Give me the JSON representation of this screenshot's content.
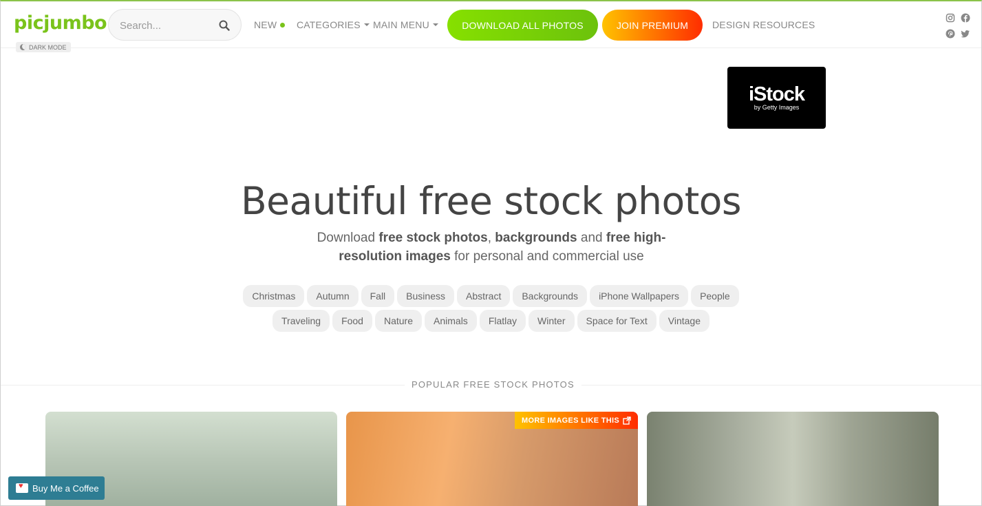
{
  "header": {
    "logo": "picjumbo",
    "dark_mode_label": "DARK MODE",
    "search_placeholder": "Search...",
    "nav": {
      "new": "NEW",
      "categories": "CATEGORIES",
      "main_menu": "MAIN MENU",
      "download_all": "DOWNLOAD ALL PHOTOS",
      "join_premium": "JOIN PREMIUM",
      "design_resources": "DESIGN RESOURCES"
    },
    "social_icons": [
      "instagram-icon",
      "facebook-icon",
      "pinterest-icon",
      "twitter-icon"
    ]
  },
  "ad": {
    "title": "iStock",
    "subtitle": "by Getty Images"
  },
  "hero": {
    "title": "Beautiful free stock photos",
    "sub_1": "Download ",
    "sub_b1": "free stock photos",
    "sub_2": ", ",
    "sub_b2": "backgrounds",
    "sub_3": " and ",
    "sub_b3": "free high-resolution images",
    "sub_4": " for personal and commercial use"
  },
  "tags_row1": [
    "Christmas",
    "Autumn",
    "Fall",
    "Business",
    "Abstract",
    "Backgrounds",
    "iPhone Wallpapers",
    "People"
  ],
  "tags_row2": [
    "Traveling",
    "Food",
    "Nature",
    "Animals",
    "Flatlay",
    "Winter",
    "Space for Text",
    "Vintage"
  ],
  "popular": {
    "heading": "POPULAR FREE STOCK PHOTOS",
    "more_badge": "MORE IMAGES LIKE THIS"
  },
  "bmc": {
    "label": "Buy Me a Coffee"
  },
  "colors": {
    "brand_green": "#7ac31b",
    "premium_gradient_start": "#ffc200",
    "premium_gradient_end": "#ff2d00",
    "bmc_blue": "#2e7d93"
  }
}
